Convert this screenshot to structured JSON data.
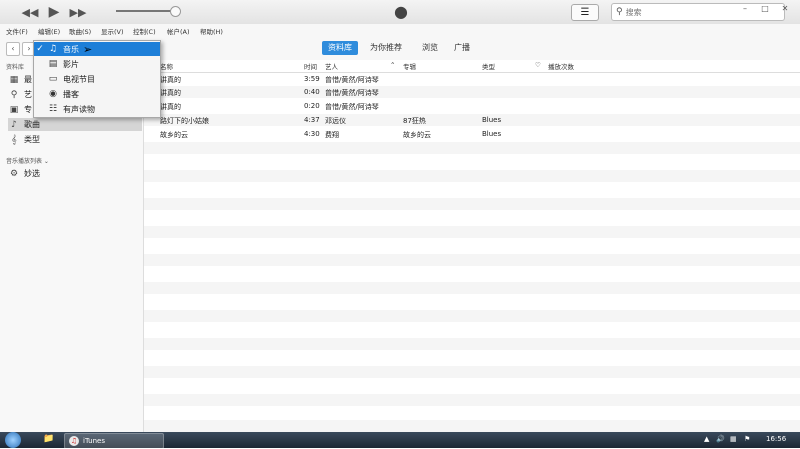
{
  "search": {
    "placeholder": "搜索"
  },
  "menubar": [
    "文件(F)",
    "编辑(E)",
    "歌曲(S)",
    "显示(V)",
    "控制(C)",
    "帐户(A)",
    "帮助(H)"
  ],
  "tabs": [
    "资料库",
    "为你推荐",
    "浏览",
    "广播"
  ],
  "dropdown": {
    "items": [
      {
        "label": "音乐",
        "icon": "music-note-icon",
        "checked": true
      },
      {
        "label": "影片",
        "icon": "film-icon"
      },
      {
        "label": "电视节目",
        "icon": "tv-icon"
      },
      {
        "label": "播客",
        "icon": "podcast-icon"
      },
      {
        "label": "有声读物",
        "icon": "audiobook-icon"
      }
    ]
  },
  "sidebar": {
    "library_label": "资料库",
    "items": [
      {
        "label": "最",
        "icon": "grid-icon"
      },
      {
        "label": "艺",
        "icon": "microphone-icon"
      },
      {
        "label": "专",
        "icon": "album-icon"
      },
      {
        "label": "歌曲",
        "icon": "music-note-icon",
        "selected": true
      },
      {
        "label": "类型",
        "icon": "genre-icon"
      }
    ],
    "playlists_label": "音乐播放列表",
    "playlists": [
      {
        "label": "妙选",
        "icon": "gear-icon"
      }
    ]
  },
  "table": {
    "columns": [
      "名称",
      "时间",
      "艺人",
      "专辑",
      "类型",
      "播放次数"
    ],
    "rows": [
      {
        "name": "讲真的",
        "time": "3:59",
        "artist": "曾惜/黄然/阿诗琴",
        "album": "",
        "genre": ""
      },
      {
        "name": "讲真的",
        "time": "0:40",
        "artist": "曾惜/黄然/阿诗琴",
        "album": "",
        "genre": ""
      },
      {
        "name": "讲真的",
        "time": "0:20",
        "artist": "曾惜/黄然/阿诗琴",
        "album": "",
        "genre": ""
      },
      {
        "name": "路灯下的小姑娘",
        "time": "4:37",
        "artist": "邓远仪",
        "album": "87狂热",
        "genre": "Blues"
      },
      {
        "name": "故乡的云",
        "time": "4:30",
        "artist": "费翔",
        "album": "故乡的云",
        "genre": "Blues"
      }
    ]
  },
  "taskbar": {
    "app_label": "iTunes",
    "clock": "16:56"
  }
}
